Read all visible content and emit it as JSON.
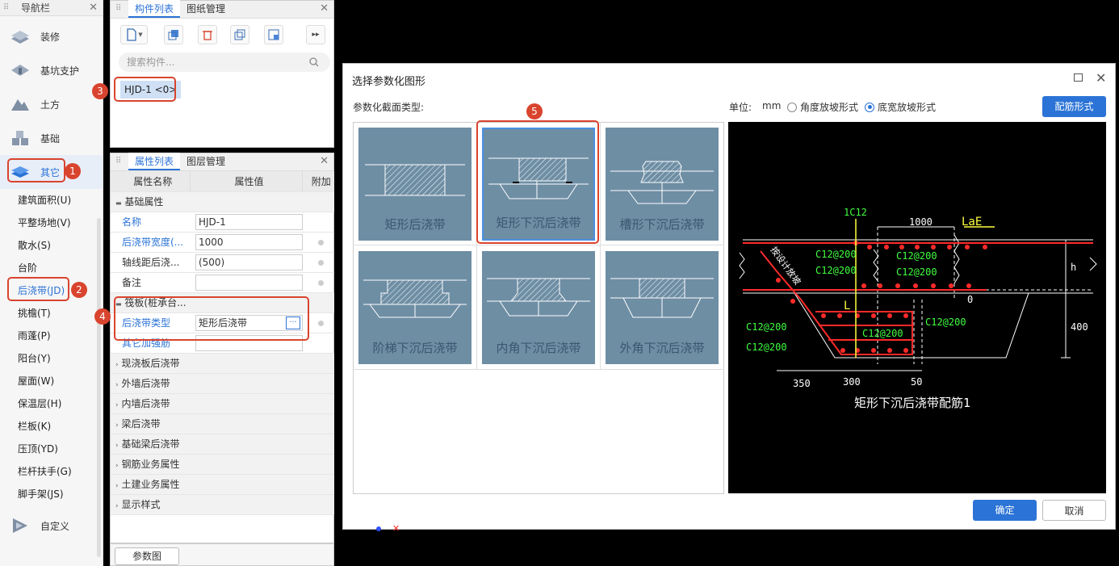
{
  "nav": {
    "title": "导航栏",
    "big": [
      "装修",
      "基坑支护",
      "土方",
      "基础",
      "其它"
    ],
    "sub": [
      "建筑面积(U)",
      "平整场地(V)",
      "散水(S)",
      "台阶",
      "后浇带(JD)",
      "挑檐(T)",
      "雨蓬(P)",
      "阳台(Y)",
      "屋面(W)",
      "保温层(H)",
      "栏板(K)",
      "压顶(YD)",
      "栏杆扶手(G)",
      "脚手架(JS)"
    ],
    "custom": "自定义"
  },
  "markers": [
    "1",
    "2",
    "3",
    "4",
    "5"
  ],
  "comp": {
    "tab1": "构件列表",
    "tab2": "图纸管理",
    "search_placeholder": "搜索构件...",
    "item": "HJD-1 <0>"
  },
  "props": {
    "tab1": "属性列表",
    "tab2": "图层管理",
    "col_name": "属性名称",
    "col_value": "属性值",
    "col_add": "附加",
    "group_basic": "基础属性",
    "rows": [
      {
        "name": "名称",
        "value": "HJD-1"
      },
      {
        "name": "后浇带宽度(...",
        "value": "1000"
      },
      {
        "name": "轴线距后浇...",
        "value": "(500)"
      },
      {
        "name": "备注",
        "value": ""
      }
    ],
    "group_raft": "筏板(桩承台...",
    "type_name": "后浇带类型",
    "type_value": "矩形后浇带",
    "extra_name": "其它加强筋",
    "groups": [
      "现浇板后浇带",
      "外墙后浇带",
      "内墙后浇带",
      "梁后浇带",
      "基础梁后浇带",
      "钢筋业务属性",
      "土建业务属性",
      "显示样式"
    ],
    "param_btn": "参数图"
  },
  "dialog": {
    "title": "选择参数化图形",
    "section_label": "参数化截面类型:",
    "unit_label": "单位:",
    "unit": "mm",
    "opt1": "角度放坡形式",
    "opt2": "底宽放坡形式",
    "rebar_btn": "配筋形式",
    "thumbs": [
      "矩形后浇带",
      "矩形下沉后浇带",
      "槽形下沉后浇带",
      "阶梯下沉后浇带",
      "内角下沉后浇带",
      "外角下沉后浇带"
    ],
    "ok": "确定",
    "cancel": "取消"
  },
  "cad": {
    "c1": "1C12",
    "w1000": "1000",
    "lae": "LaE",
    "r1": "C12@200",
    "r2": "C12@200",
    "r3": "C12@200",
    "r4": "C12@200",
    "r5": "C12@200",
    "r6": "C12@200",
    "r7": "C12@200",
    "r8": "C12@200",
    "h": "h",
    "zero": "0",
    "four": "400",
    "L": "L",
    "d350": "350",
    "d300": "300",
    "d50": "50",
    "side": "按设计放坡",
    "title": "矩形下沉后浇带配筋1"
  },
  "colors": {
    "accent": "#2b73d6",
    "marker": "#d9442e",
    "thumb_bg": "#6e8ea4"
  }
}
